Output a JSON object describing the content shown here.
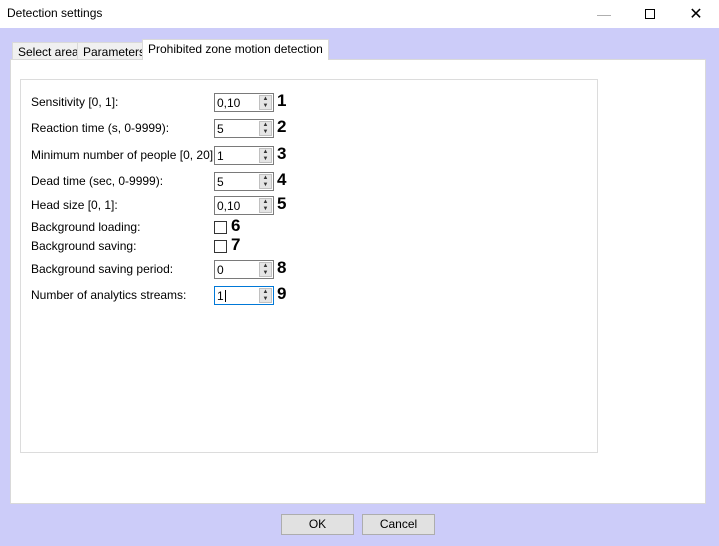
{
  "window": {
    "title": "Detection settings",
    "controls": [
      "minimize",
      "maximize",
      "close"
    ]
  },
  "tabs": [
    {
      "label": "Select area"
    },
    {
      "label": "Parameters"
    },
    {
      "label": "Prohibited zone motion detection",
      "active": true
    }
  ],
  "fields": [
    {
      "label": "Sensitivity [0, 1]:",
      "value": "0,10",
      "type": "spin",
      "marker": "1"
    },
    {
      "label": "Reaction time (s, 0-9999):",
      "value": "5",
      "type": "spin",
      "marker": "2"
    },
    {
      "label": "Minimum number of people [0, 20]:",
      "value": "1",
      "type": "spin",
      "marker": "3"
    },
    {
      "label": "Dead time (sec, 0-9999):",
      "value": "5",
      "type": "spin",
      "marker": "4"
    },
    {
      "label": "Head size [0, 1]:",
      "value": "0,10",
      "type": "spin",
      "marker": "5"
    },
    {
      "label": "Background loading:",
      "checked": false,
      "type": "check",
      "marker": "6"
    },
    {
      "label": "Background saving:",
      "checked": false,
      "type": "check",
      "marker": "7"
    },
    {
      "label": "Background saving period:",
      "value": "0",
      "type": "spin",
      "marker": "8"
    },
    {
      "label": "Number of analytics streams:",
      "value": "1",
      "type": "spin",
      "marker": "9",
      "focused": true
    }
  ],
  "buttons": {
    "ok": "OK",
    "cancel": "Cancel"
  }
}
